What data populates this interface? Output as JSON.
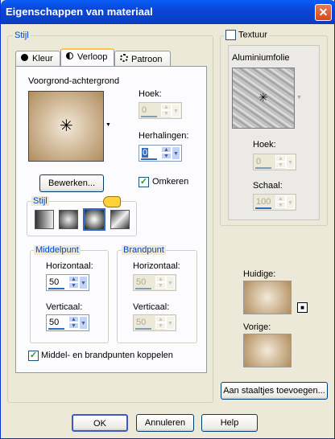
{
  "window": {
    "title": "Eigenschappen van materiaal",
    "close_icon": "✕"
  },
  "left": {
    "group_title": "Stijl",
    "tabs": [
      {
        "label": "Kleur",
        "icon": "filled-circle-icon"
      },
      {
        "label": "Verloop",
        "icon": "half-circle-icon"
      },
      {
        "label": "Patroon",
        "icon": "pattern-icon"
      }
    ],
    "gradient_label": "Voorgrond-achtergrond",
    "edit_button": "Bewerken...",
    "angle": {
      "label": "Hoek:",
      "value": "0"
    },
    "repeats": {
      "label": "Herhalingen:",
      "value": "0"
    },
    "invert": {
      "label": "Omkeren",
      "checked": true
    },
    "style_group": "Stijl",
    "style_options": [
      "linear-style",
      "rectangular-style",
      "radial-style",
      "sunburst-style"
    ],
    "center": {
      "group": "Middelpunt",
      "h_label": "Horizontaal:",
      "h_value": "50",
      "v_label": "Verticaal:",
      "v_value": "50"
    },
    "focal": {
      "group": "Brandpunt",
      "h_label": "Horizontaal:",
      "h_value": "50",
      "v_label": "Verticaal:",
      "v_value": "50"
    },
    "link": {
      "label": "Middel- en brandpunten koppelen",
      "checked": true
    }
  },
  "right": {
    "texture_label": "Textuur",
    "texture_checked": false,
    "texture_name": "Aluminiumfolie",
    "angle": {
      "label": "Hoek:",
      "value": "0"
    },
    "scale": {
      "label": "Schaal:",
      "value": "100"
    },
    "current_label": "Huidige:",
    "previous_label": "Vorige:",
    "add_swatch_button": "Aan staaltjes toevoegen..."
  },
  "footer": {
    "ok": "OK",
    "cancel": "Annuleren",
    "help": "Help"
  },
  "colors": {
    "accent": "#0046d5",
    "gradient_center": "#f3e9da",
    "gradient_edge": "#b08c5e"
  }
}
